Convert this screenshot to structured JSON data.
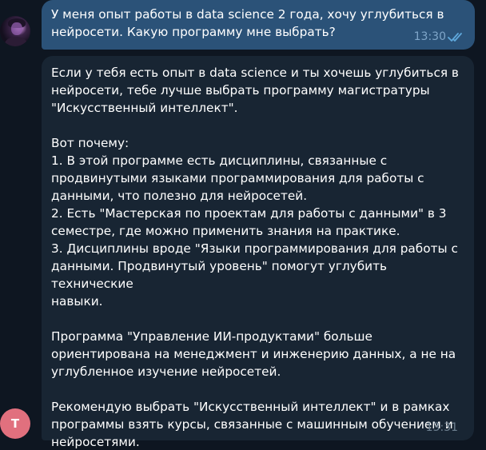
{
  "user_message": {
    "text": "У меня опыт работы в data science 2 года, хочу углубиться в\nнейросети. Какую программу мне выбрать?",
    "time": "13:30",
    "status_icon": "double-check-icon"
  },
  "bot_message": {
    "avatar_letter": "T",
    "text": "Если у тебя есть опыт в data science и ты хочешь углубиться в\nнейросети, тебе лучше выбрать программу магистратуры\n\"Искусственный интеллект\".\n\nВот почему:\n1. В этой программе есть дисциплины, связанные с\nпродвинутыми языками программирования для работы с\nданными, что полезно для нейросетей.\n2. Есть \"Мастерская по проектам для работы с данными\" в 3\nсеместре, где можно применить знания на практике.\n3. Дисциплины вроде \"Языки программирования для работы с\nданными. Продвинутый уровень\" помогут углубить технические\nнавыки.\n\nПрограмма \"Управление ИИ-продуктами\" больше\nориентирована на менеджмент и инженерию данных, а не на\nуглубленное изучение нейросетей.\n\nРекомендую выбрать \"Искусственный интеллект\" и в рамках\nпрограммы взять курсы, связанные с машинным обучением и\nнейросетями.",
    "time": "13:31"
  },
  "colors": {
    "background": "#0e1621",
    "outgoing_bubble": "#2b5278",
    "incoming_bubble": "#182533",
    "check_color": "#4fae4e",
    "bot_avatar": "#e1707e"
  }
}
